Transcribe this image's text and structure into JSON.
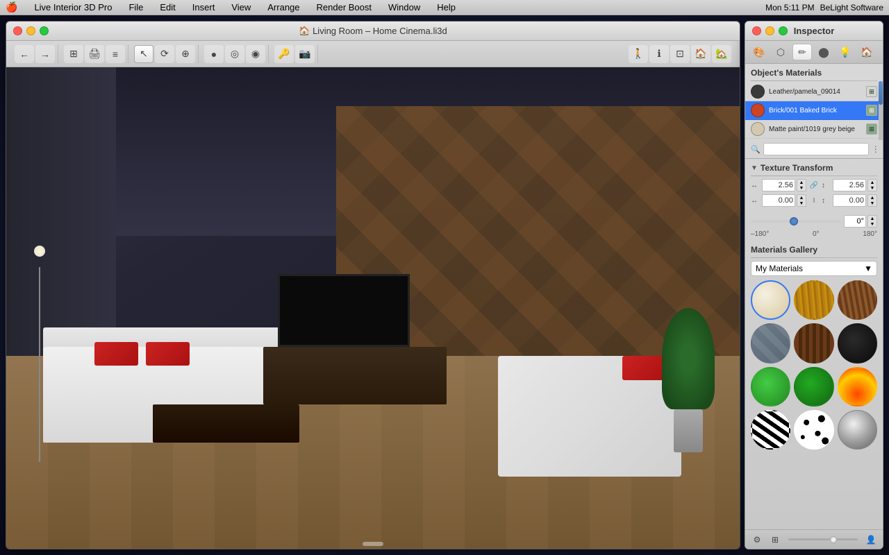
{
  "menubar": {
    "apple": "🍎",
    "app_name": "Live Interior 3D Pro",
    "menus": [
      "File",
      "Edit",
      "Insert",
      "View",
      "Arrange",
      "Render Boost",
      "Window",
      "Help"
    ],
    "right": {
      "time": "Mon 5:11 PM",
      "company": "BeLight Software"
    }
  },
  "main_window": {
    "title": "🏠 Living Room – Home Cinema.li3d",
    "traffic_lights": {
      "close": "close",
      "minimize": "minimize",
      "maximize": "maximize"
    },
    "toolbar": {
      "nav_back": "←",
      "nav_forward": "→",
      "tools": [
        "⊞",
        "🖨",
        "≡",
        "↖",
        "⟳",
        "⊕",
        "●",
        "◎",
        "◉",
        "🔑",
        "📷"
      ],
      "view_btns": [
        "🚶",
        "ℹ",
        "⊡",
        "🏠",
        "🏡"
      ]
    }
  },
  "inspector": {
    "title": "Inspector",
    "traffic_lights": {
      "close": "close",
      "minimize": "minimize",
      "maximize": "maximize"
    },
    "tabs": [
      {
        "id": "materials",
        "icon": "🎨",
        "active": false
      },
      {
        "id": "object",
        "icon": "⬡",
        "active": false
      },
      {
        "id": "paint",
        "icon": "✏",
        "active": true
      },
      {
        "id": "texture",
        "icon": "⬤",
        "active": false
      },
      {
        "id": "light",
        "icon": "💡",
        "active": false
      },
      {
        "id": "room",
        "icon": "🏠",
        "active": false
      }
    ],
    "objects_materials": {
      "label": "Object's Materials",
      "items": [
        {
          "name": "Leather/pamela_09014",
          "swatch_color": "#3a3a3a",
          "selected": false
        },
        {
          "name": "Brick/001 Baked Brick",
          "swatch_color": "#cc4422",
          "selected": true
        },
        {
          "name": "Matte paint/1019 grey beige",
          "swatch_color": "#d4c8b0",
          "selected": false
        }
      ]
    },
    "texture_transform": {
      "label": "Texture Transform",
      "width_val": "2.56",
      "height_val": "2.56",
      "offset_x": "0.00",
      "offset_y": "0.00",
      "angle_val": "0°",
      "angle_neg": "–180°",
      "angle_zero": "0°",
      "angle_pos": "180°"
    },
    "materials_gallery": {
      "label": "Materials Gallery",
      "dropdown_value": "My Materials",
      "items": [
        {
          "id": "cream",
          "class": "gi-cream",
          "selected": true
        },
        {
          "id": "wood1",
          "class": "gi-wood1",
          "selected": false
        },
        {
          "id": "wood2",
          "class": "gi-wood2",
          "selected": false
        },
        {
          "id": "stone",
          "class": "gi-stone",
          "selected": false
        },
        {
          "id": "brown-wood",
          "class": "gi-brown-wood",
          "selected": false
        },
        {
          "id": "dark",
          "class": "gi-dark",
          "selected": false
        },
        {
          "id": "green1",
          "class": "gi-green1",
          "selected": false
        },
        {
          "id": "green2",
          "class": "gi-green2",
          "selected": false
        },
        {
          "id": "fire",
          "class": "gi-fire",
          "selected": false
        },
        {
          "id": "zebra",
          "class": "gi-zebra",
          "selected": false
        },
        {
          "id": "spots",
          "class": "gi-spots",
          "selected": false
        },
        {
          "id": "metal",
          "class": "gi-metal",
          "selected": false
        }
      ]
    }
  }
}
